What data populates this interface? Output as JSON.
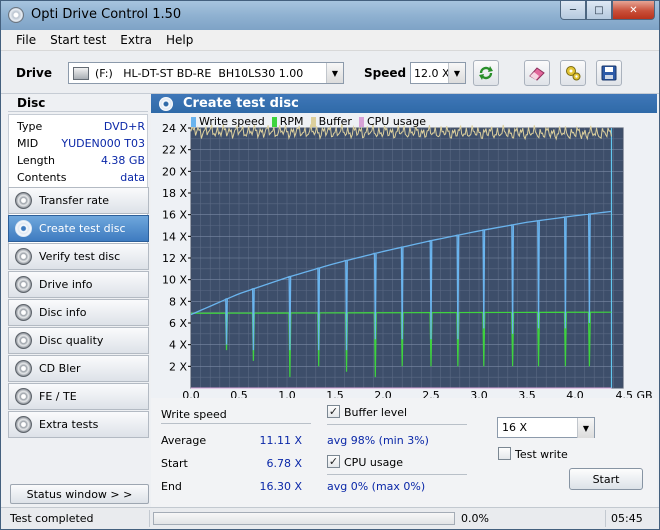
{
  "window": {
    "title": "Opti Drive Control 1.50"
  },
  "menu": [
    "File",
    "Start test",
    "Extra",
    "Help"
  ],
  "toolbar": {
    "drive_label": "Drive",
    "drive_value": "(F:)   HL-DT-ST BD-RE  BH10LS30 1.00",
    "speed_label": "Speed",
    "speed_value": "12.0 X"
  },
  "disc": {
    "title": "Disc",
    "rows": [
      {
        "key": "Type",
        "value": "DVD+R"
      },
      {
        "key": "MID",
        "value": "YUDEN000 T03"
      },
      {
        "key": "Length",
        "value": "4.38 GB"
      },
      {
        "key": "Contents",
        "value": "data"
      }
    ]
  },
  "nav": [
    {
      "label": "Transfer rate",
      "active": false
    },
    {
      "label": "Create test disc",
      "active": true
    },
    {
      "label": "Verify test disc",
      "active": false
    },
    {
      "label": "Drive info",
      "active": false
    },
    {
      "label": "Disc info",
      "active": false
    },
    {
      "label": "Disc quality",
      "active": false
    },
    {
      "label": "CD Bler",
      "active": false
    },
    {
      "label": "FE / TE",
      "active": false
    },
    {
      "label": "Extra tests",
      "active": false
    }
  ],
  "status_window_label": "Status window > >",
  "panel_title": "Create test disc",
  "chart_data": {
    "type": "line",
    "legend": [
      {
        "name": "Write speed",
        "color": "#6ab4ee"
      },
      {
        "name": "RPM",
        "color": "#3ed43e"
      },
      {
        "name": "Buffer",
        "color": "#dccf9c"
      },
      {
        "name": "CPU usage",
        "color": "#d7a2d7"
      }
    ],
    "y_ticks": [
      "2 X",
      "4 X",
      "6 X",
      "8 X",
      "10 X",
      "12 X",
      "14 X",
      "16 X",
      "18 X",
      "20 X",
      "22 X",
      "24 X"
    ],
    "x_ticks": [
      "0.0",
      "0.5",
      "1.0",
      "1.5",
      "2.0",
      "2.5",
      "3.0",
      "3.5",
      "4.0",
      "4.5 GB"
    ],
    "xlim": [
      0,
      4.5
    ],
    "ylim": [
      0,
      24
    ],
    "grid": true,
    "series": [
      {
        "name": "Write speed",
        "x": [
          0.0,
          0.5,
          1.0,
          1.5,
          2.0,
          2.5,
          3.0,
          3.5,
          4.0,
          4.38
        ],
        "values": [
          6.78,
          8.7,
          10.2,
          11.5,
          12.6,
          13.6,
          14.5,
          15.3,
          15.9,
          16.3
        ]
      },
      {
        "name": "RPM",
        "x": [
          0.0,
          4.38
        ],
        "values": [
          6.9,
          7.0
        ]
      },
      {
        "name": "Buffer",
        "x": [
          0.0,
          4.38
        ],
        "values": [
          23.7,
          23.5
        ]
      },
      {
        "name": "CPU usage",
        "x": [
          0.0,
          4.38
        ],
        "values": [
          0,
          0
        ]
      }
    ],
    "write_dips_x": [
      0.37,
      0.65,
      1.03,
      1.33,
      1.62,
      1.92,
      2.2,
      2.5,
      2.78,
      3.05,
      3.35,
      3.62,
      3.9,
      4.15
    ],
    "write_dips_y": [
      4.0,
      3.5,
      3.5,
      3.5,
      3.5,
      4.5,
      4.5,
      4.5,
      4.5,
      5.5,
      5.0,
      5.5,
      5.5,
      6.0
    ],
    "rpm_dips_y": [
      3.5,
      2.5,
      1.0,
      2.0,
      1.5,
      1.0,
      2.0,
      2.0,
      2.0,
      2.0,
      2.0,
      2.0,
      2.0,
      2.0
    ]
  },
  "stats": {
    "write_speed_title": "Write speed",
    "average_label": "Average",
    "average_value": "11.11 X",
    "start_label": "Start",
    "start_value": "6.78 X",
    "end_label": "End",
    "end_value": "16.30 X",
    "buffer_label": "Buffer level",
    "buffer_value": "avg 98% (min 3%)",
    "cpu_label": "CPU usage",
    "cpu_value": "avg 0% (max 0%)",
    "speed_select": "16 X",
    "test_write_label": "Test write",
    "start_button": "Start"
  },
  "statusbar": {
    "text": "Test completed",
    "percent": "0.0%",
    "progress": 0.0,
    "time": "05:45"
  }
}
